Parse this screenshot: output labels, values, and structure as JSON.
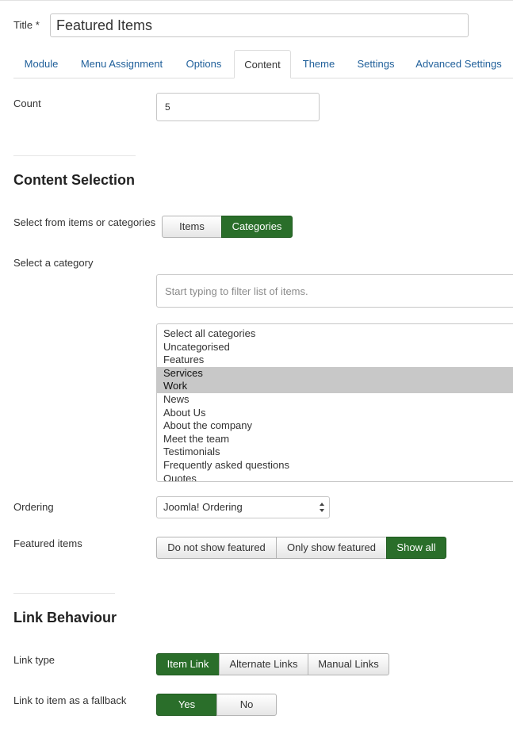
{
  "title": {
    "label": "Title",
    "required_mark": "*",
    "value": "Featured Items"
  },
  "tabs": [
    {
      "label": "Module",
      "active": false
    },
    {
      "label": "Menu Assignment",
      "active": false
    },
    {
      "label": "Options",
      "active": false
    },
    {
      "label": "Content",
      "active": true
    },
    {
      "label": "Theme",
      "active": false
    },
    {
      "label": "Settings",
      "active": false
    },
    {
      "label": "Advanced Settings",
      "active": false
    }
  ],
  "count": {
    "label": "Count",
    "value": "5"
  },
  "content_selection": {
    "heading": "Content Selection",
    "source": {
      "label": "Select from items or categories",
      "options": [
        "Items",
        "Categories"
      ],
      "selected": "Categories"
    },
    "category": {
      "label": "Select a category",
      "filter_placeholder": "Start typing to filter list of items.",
      "options": [
        {
          "label": "Select all categories",
          "selected": false
        },
        {
          "label": "Uncategorised",
          "selected": false
        },
        {
          "label": "Features",
          "selected": false
        },
        {
          "label": "Services",
          "selected": true
        },
        {
          "label": "Work",
          "selected": true
        },
        {
          "label": "News",
          "selected": false
        },
        {
          "label": "About Us",
          "selected": false
        },
        {
          "label": "About the company",
          "selected": false
        },
        {
          "label": "Meet the team",
          "selected": false
        },
        {
          "label": "Testimonials",
          "selected": false
        },
        {
          "label": "Frequently asked questions",
          "selected": false
        },
        {
          "label": "Quotes",
          "selected": false
        }
      ]
    },
    "ordering": {
      "label": "Ordering",
      "value": "Joomla! Ordering"
    },
    "featured": {
      "label": "Featured items",
      "options": [
        "Do not show featured",
        "Only show featured",
        "Show all"
      ],
      "selected": "Show all"
    }
  },
  "link_behaviour": {
    "heading": "Link Behaviour",
    "link_type": {
      "label": "Link type",
      "options": [
        "Item Link",
        "Alternate Links",
        "Manual Links"
      ],
      "selected": "Item Link"
    },
    "fallback": {
      "label": "Link to item as a fallback",
      "options": [
        "Yes",
        "No"
      ],
      "selected": "Yes"
    }
  },
  "colors": {
    "accent_green": "#2a6e2a",
    "link_blue": "#1f5f9a"
  },
  "icons": {
    "ordering_select": "up-down-arrows-icon"
  }
}
